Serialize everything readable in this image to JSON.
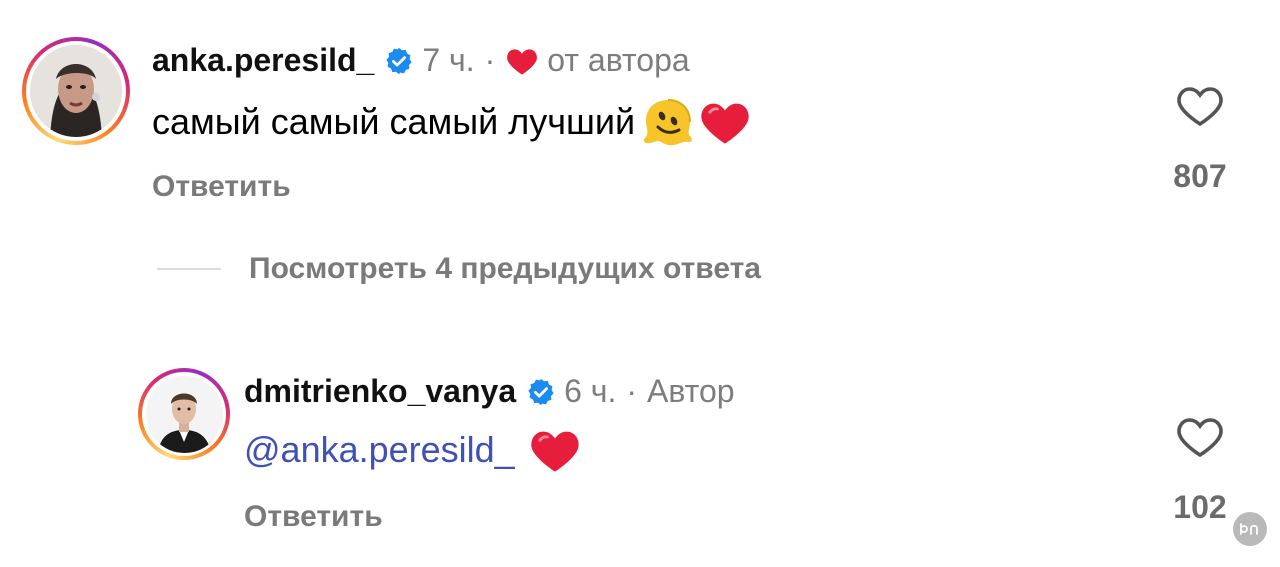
{
  "comments": [
    {
      "username": "anka.peresild_",
      "time": "7 ч.",
      "separator": "·",
      "meta_label": "от автора",
      "text": "самый самый самый лучший",
      "reply_label": "Ответить",
      "like_count": "807"
    },
    {
      "username": "dmitrienko_vanya",
      "time": "6 ч.",
      "separator": "·",
      "meta_label": "Автор",
      "mention": "@anka.peresild_",
      "reply_label": "Ответить",
      "like_count": "102"
    }
  ],
  "view_replies_label": "Посмотреть 4 предыдущих ответа",
  "colors": {
    "verified_blue": "#1a8cf0",
    "heart_red": "#e61e3c",
    "mention_blue": "#3f51b5",
    "muted_gray": "#7a7a7a"
  },
  "icons": {
    "verified": "verified-badge-icon",
    "small_heart": "heart-filled-icon",
    "like": "heart-outline-icon",
    "emoji_melting": "melting-face-emoji-icon",
    "emoji_heart": "red-heart-emoji-icon"
  }
}
